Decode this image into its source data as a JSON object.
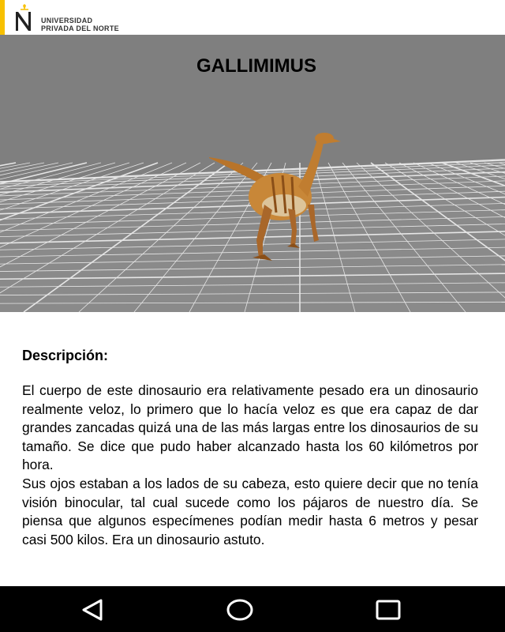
{
  "header": {
    "logo_line1": "UNIVERSIDAD",
    "logo_line2": "PRIVADA DEL NORTE",
    "accent_color": "#f7c000"
  },
  "viewer": {
    "title": "GALLIMIMUS",
    "background_color": "#7f7f7f",
    "grid_color": "#e6e6e6"
  },
  "content": {
    "heading": "Descripción:",
    "paragraph1": "El cuerpo de este dinosaurio era relativamente pesado era un dinosaurio realmente veloz, lo primero que lo hacía veloz es que era capaz de dar grandes zancadas quizá una de las más largas entre los dinosaurios de su tamaño. Se dice que pudo haber alcanzado hasta los 60 kilómetros por hora.",
    "paragraph2": "Sus ojos estaban a los lados de su cabeza, esto quiere decir que no tenía visión binocular, tal cual sucede como los pájaros de nuestro día. Se piensa que algunos especímenes podían medir hasta 6 metros y pesar casi 500 kilos. Era un dinosaurio astuto."
  },
  "navbar": {
    "back_icon": "back-triangle-icon",
    "home_icon": "home-circle-icon",
    "recents_icon": "recents-square-icon"
  }
}
